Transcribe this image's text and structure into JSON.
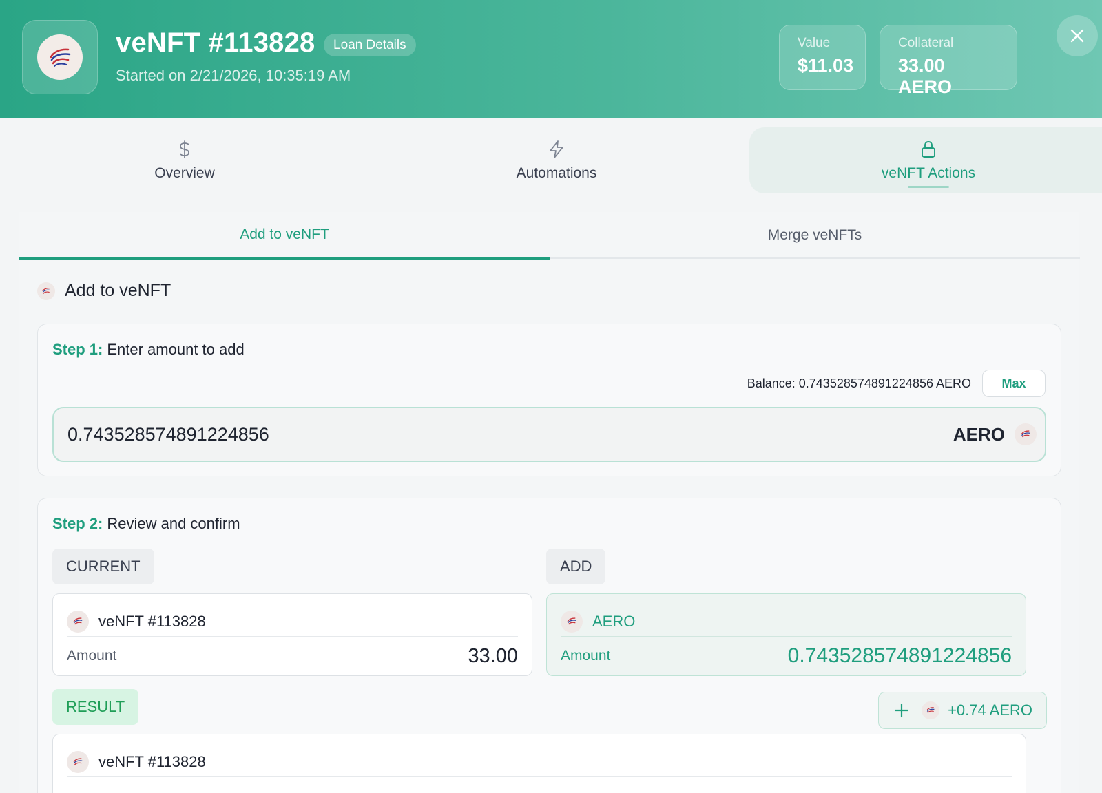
{
  "header": {
    "title": "veNFT #113828",
    "badge": "Loan Details",
    "started": "Started on 2/21/2026, 10:35:19 AM",
    "stats": [
      {
        "label": "Value",
        "value": "$11.03"
      },
      {
        "label": "Collateral",
        "value": "33.00 AERO"
      }
    ],
    "accent_color": "#2aa586"
  },
  "main_tabs": [
    {
      "label": "Overview",
      "icon": "dollar-icon"
    },
    {
      "label": "Automations",
      "icon": "lightning-icon"
    },
    {
      "label": "veNFT Actions",
      "icon": "lock-icon",
      "active": true
    }
  ],
  "sub_tabs": [
    {
      "label": "Add to veNFT",
      "active": true
    },
    {
      "label": "Merge veNFTs"
    }
  ],
  "section": {
    "title": "Add to veNFT"
  },
  "step1": {
    "num": "Step 1:",
    "text": "Enter amount to add",
    "balance": "Balance: 0.743528574891224856 AERO",
    "max_label": "Max",
    "amount_value": "0.743528574891224856",
    "token": "AERO"
  },
  "step2": {
    "num": "Step 2:",
    "text": "Review and confirm",
    "current_label": "CURRENT",
    "add_label": "ADD",
    "result_label": "RESULT",
    "current": {
      "name": "veNFT #113828",
      "amount_label": "Amount",
      "amount": "33.00"
    },
    "add": {
      "name": "AERO",
      "amount_label": "Amount",
      "amount": "0.743528574891224856"
    },
    "delta": "+0.74 AERO",
    "result": {
      "name": "veNFT #113828"
    }
  }
}
